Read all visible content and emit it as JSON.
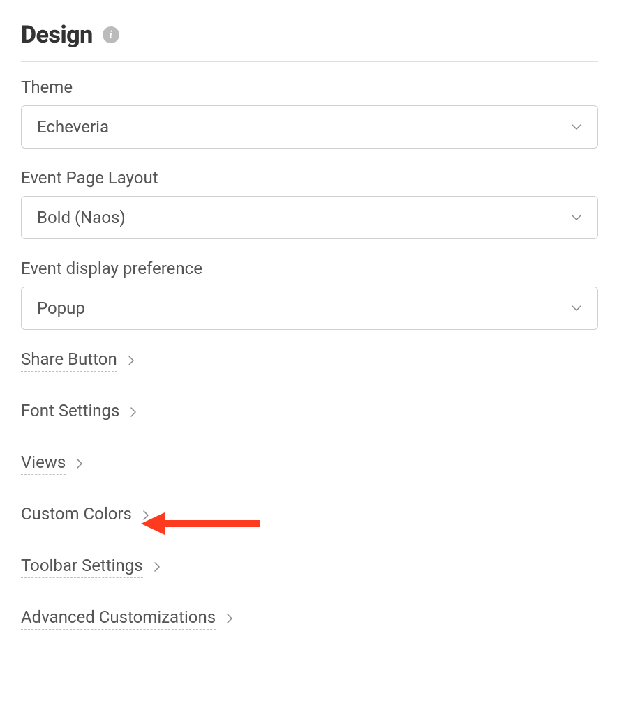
{
  "header": {
    "title": "Design"
  },
  "fields": {
    "theme": {
      "label": "Theme",
      "value": "Echeveria"
    },
    "eventPageLayout": {
      "label": "Event Page Layout",
      "value": "Bold (Naos)"
    },
    "eventDisplayPreference": {
      "label": "Event display preference",
      "value": "Popup"
    }
  },
  "links": {
    "shareButton": "Share Button",
    "fontSettings": "Font Settings",
    "views": "Views",
    "customColors": "Custom Colors",
    "toolbarSettings": "Toolbar Settings",
    "advancedCustomizations": "Advanced Customizations"
  }
}
